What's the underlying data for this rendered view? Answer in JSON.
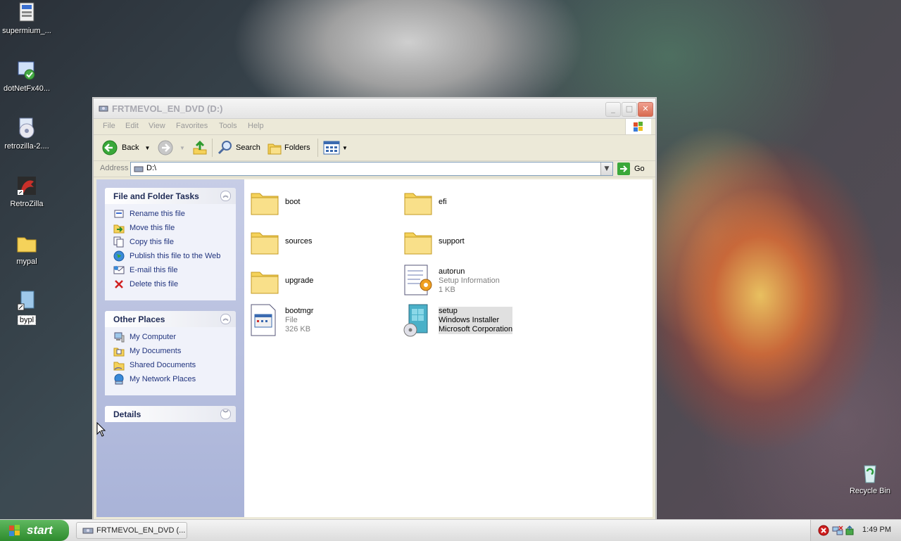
{
  "desktop": {
    "icons": [
      {
        "label": "supermium_..."
      },
      {
        "label": "dotNetFx40..."
      },
      {
        "label": "retrozilla-2...."
      },
      {
        "label": "RetroZilla"
      },
      {
        "label": "mypal"
      },
      {
        "label": "bypl"
      },
      {
        "label": "Recycle Bin"
      }
    ]
  },
  "window": {
    "title": "FRTMEVOL_EN_DVD (D:)",
    "menu": [
      "File",
      "Edit",
      "View",
      "Favorites",
      "Tools",
      "Help"
    ],
    "toolbar": {
      "back": "Back",
      "search": "Search",
      "folders": "Folders"
    },
    "address": {
      "label": "Address",
      "value": "D:\\",
      "go": "Go"
    },
    "file_tasks": {
      "title": "File and Folder Tasks",
      "items": [
        "Rename this file",
        "Move this file",
        "Copy this file",
        "Publish this file to the Web",
        "E-mail this file",
        "Delete this file"
      ]
    },
    "other_places": {
      "title": "Other Places",
      "items": [
        "My Computer",
        "My Documents",
        "Shared Documents",
        "My Network Places"
      ]
    },
    "details": {
      "title": "Details"
    },
    "files": [
      {
        "name": "boot",
        "line2": "",
        "line3": ""
      },
      {
        "name": "efi",
        "line2": "",
        "line3": ""
      },
      {
        "name": "sources",
        "line2": "",
        "line3": ""
      },
      {
        "name": "support",
        "line2": "",
        "line3": ""
      },
      {
        "name": "upgrade",
        "line2": "",
        "line3": ""
      },
      {
        "name": "autorun",
        "line2": "Setup Information",
        "line3": "1 KB"
      },
      {
        "name": "bootmgr",
        "line2": "File",
        "line3": "326 KB"
      },
      {
        "name": "setup",
        "line2": "Windows Installer",
        "line3": "Microsoft Corporation"
      }
    ]
  },
  "taskbar": {
    "start": "start",
    "task": "FRTMEVOL_EN_DVD (...",
    "clock": "1:49 PM"
  }
}
